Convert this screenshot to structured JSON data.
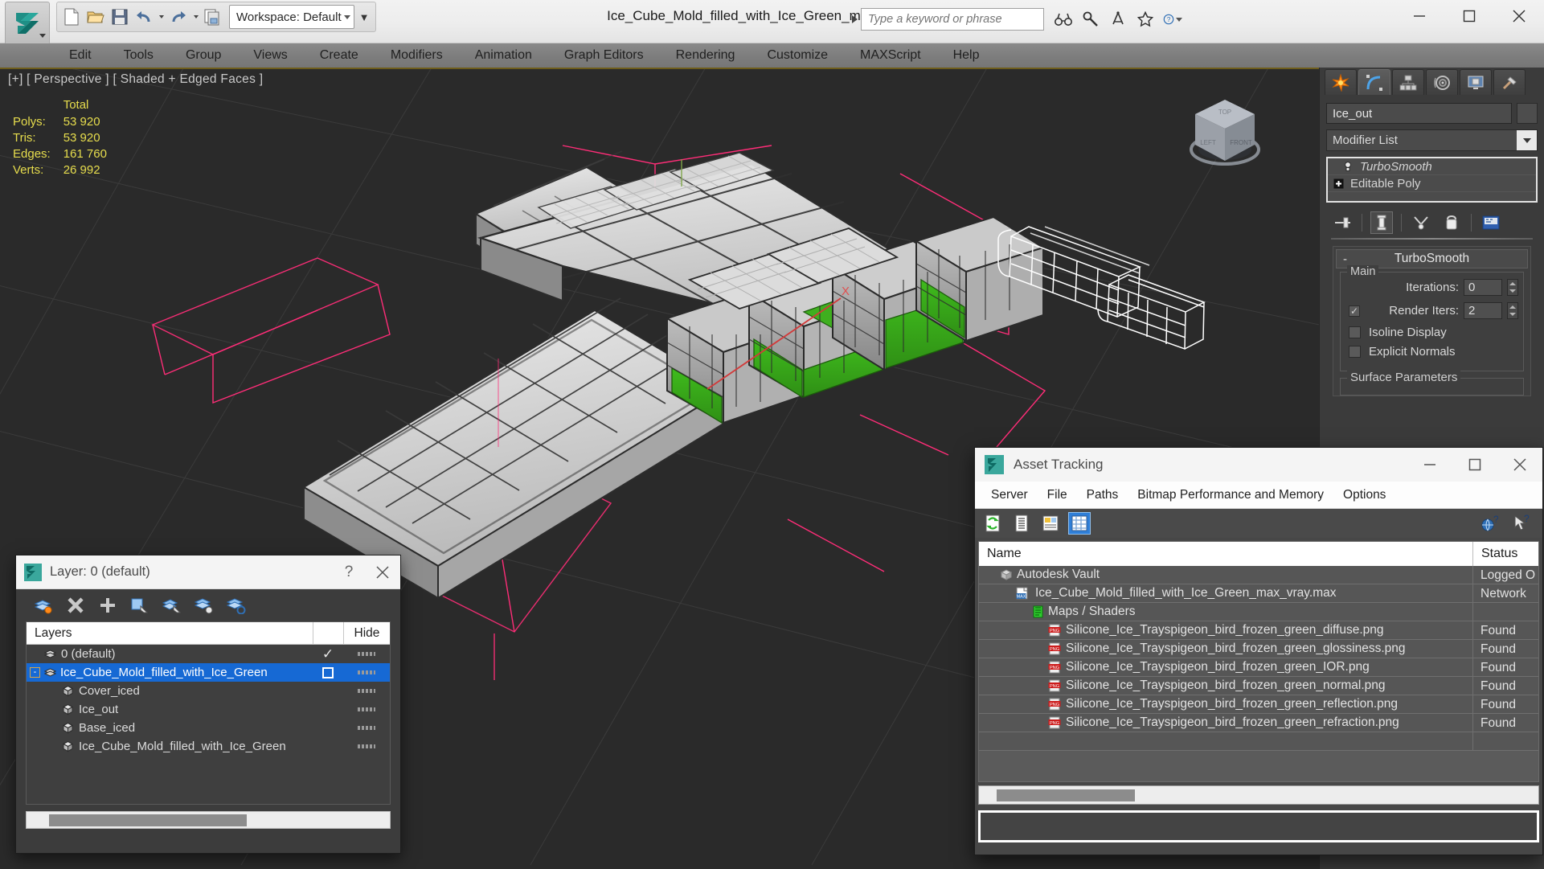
{
  "app": {
    "window_title": "Ice_Cube_Mold_filled_with_Ice_Green_max_vray.max",
    "logo_name": "3ds-max-logo"
  },
  "quick_access": {
    "workspace_label": "Workspace: Default",
    "buttons": [
      {
        "name": "new-file-icon",
        "tip": "New"
      },
      {
        "name": "open-file-icon",
        "tip": "Open"
      },
      {
        "name": "save-file-icon",
        "tip": "Save"
      },
      {
        "name": "undo-icon",
        "tip": "Undo"
      },
      {
        "name": "redo-icon",
        "tip": "Redo"
      },
      {
        "name": "project-folder-icon",
        "tip": "Set Project Folder"
      }
    ]
  },
  "search": {
    "placeholder": "Type a keyword or phrase",
    "icons": [
      "binoculars-icon",
      "wrench-icon",
      "compass-icon",
      "star-icon",
      "help-icon"
    ]
  },
  "window_controls": [
    "minimize",
    "maximize",
    "close"
  ],
  "menubar": {
    "items": [
      "Edit",
      "Tools",
      "Group",
      "Views",
      "Create",
      "Modifiers",
      "Animation",
      "Graph Editors",
      "Rendering",
      "Customize",
      "MAXScript",
      "Help"
    ]
  },
  "viewport": {
    "label": "[+] [ Perspective ] [ Shaded + Edged Faces ]",
    "stats": {
      "header": "Total",
      "rows": [
        {
          "label": "Polys:",
          "value": "53 920"
        },
        {
          "label": "Tris:",
          "value": "53 920"
        },
        {
          "label": "Edges:",
          "value": "161 760"
        },
        {
          "label": "Verts:",
          "value": "26 992"
        }
      ]
    },
    "viewcube": {
      "top": "TOP",
      "front": "FRONT",
      "left": "LEFT"
    },
    "gizmo_axis_label": "X",
    "colors": {
      "background": "#2a2a2a",
      "grid": "#3a3a3a",
      "selection_helper": "#ff2d78",
      "axis_x": "#d23a3a",
      "mesh_light": "#d8d8d8",
      "mesh_dark": "#3a3a3a",
      "ice_green": "#3faf1f",
      "wireframe_white": "#ffffff"
    }
  },
  "command_panel": {
    "tabs": [
      {
        "name": "create-tab",
        "icon": "star-burst-icon",
        "active": false
      },
      {
        "name": "modify-tab",
        "icon": "bent-arc-icon",
        "active": true
      },
      {
        "name": "hierarchy-tab",
        "icon": "hierarchy-icon",
        "active": false
      },
      {
        "name": "motion-tab",
        "icon": "motion-wheel-icon",
        "active": false
      },
      {
        "name": "display-tab",
        "icon": "monitor-icon",
        "active": false
      },
      {
        "name": "utilities-tab",
        "icon": "hammer-icon",
        "active": false
      }
    ],
    "object_name": "Ice_out",
    "modifier_list_label": "Modifier List",
    "modifier_stack": [
      {
        "label": "TurboSmooth",
        "italic": true,
        "icon": "lightbulb-icon"
      },
      {
        "label": "Editable Poly",
        "italic": false,
        "icon": "plus-box-icon"
      }
    ],
    "stack_tools": [
      {
        "name": "pin-stack-icon"
      },
      {
        "name": "show-end-result-icon"
      },
      {
        "name": "make-unique-icon"
      },
      {
        "name": "remove-modifier-icon"
      },
      {
        "name": "configure-modifier-sets-icon"
      }
    ],
    "rollout": {
      "title": "TurboSmooth",
      "collapse_symbol": "-",
      "group_main": "Main",
      "iterations_label": "Iterations:",
      "iterations_value": "0",
      "render_iters_label": "Render Iters:",
      "render_iters_value": "2",
      "render_iters_checked": true,
      "isoline_display": "Isoline Display",
      "explicit_normals": "Explicit Normals",
      "surface_parameters": "Surface Parameters"
    }
  },
  "layer_dialog": {
    "title": "Layer: 0 (default)",
    "help_symbol": "?",
    "tools": [
      {
        "name": "make-layer-current-icon"
      },
      {
        "name": "delete-layer-icon"
      },
      {
        "name": "create-new-layer-icon"
      },
      {
        "name": "add-selection-to-layer-icon"
      },
      {
        "name": "select-objects-in-layer-icon"
      },
      {
        "name": "set-layer-to-selection-icon"
      },
      {
        "name": "layer-settings-icon"
      }
    ],
    "columns": {
      "name": "Layers",
      "hide": "Hide"
    },
    "rows": [
      {
        "label": "0 (default)",
        "indent": 0,
        "icon": "layer-stack-icon",
        "selected": false,
        "current": true,
        "expander": ""
      },
      {
        "label": "Ice_Cube_Mold_filled_with_Ice_Green",
        "indent": 0,
        "icon": "layer-stack-icon",
        "selected": true,
        "current": false,
        "expander": "-"
      },
      {
        "label": "Cover_iced",
        "indent": 1,
        "icon": "object-cube-icon",
        "selected": false,
        "current": false,
        "expander": ""
      },
      {
        "label": "Ice_out",
        "indent": 1,
        "icon": "object-cube-icon",
        "selected": false,
        "current": false,
        "expander": ""
      },
      {
        "label": "Base_iced",
        "indent": 1,
        "icon": "object-cube-icon",
        "selected": false,
        "current": false,
        "expander": ""
      },
      {
        "label": "Ice_Cube_Mold_filled_with_Ice_Green",
        "indent": 1,
        "icon": "object-cube-icon",
        "selected": false,
        "current": false,
        "expander": ""
      }
    ]
  },
  "asset_tracking": {
    "title": "Asset Tracking",
    "menu": [
      "Server",
      "File",
      "Paths",
      "Bitmap Performance and Memory",
      "Options"
    ],
    "toolbar": [
      {
        "name": "refresh-icon",
        "active": false
      },
      {
        "name": "list-view-icon",
        "active": false
      },
      {
        "name": "detail-view-icon",
        "active": false
      },
      {
        "name": "grid-view-icon",
        "active": true
      }
    ],
    "toolbar_right": [
      {
        "name": "help-globe-icon"
      },
      {
        "name": "help-cursor-icon"
      }
    ],
    "columns": [
      "Name",
      "Status"
    ],
    "rows": [
      {
        "name": "Autodesk Vault",
        "status": "Logged O",
        "indent": 1,
        "icon": "vault-icon"
      },
      {
        "name": "Ice_Cube_Mold_filled_with_Ice_Green_max_vray.max",
        "status": "Network",
        "indent": 2,
        "icon": "max-file-icon"
      },
      {
        "name": "Maps / Shaders",
        "status": "",
        "indent": 3,
        "icon": "maps-shaders-icon"
      },
      {
        "name": "Silicone_Ice_Trayspigeon_bird_frozen_green_diffuse.png",
        "status": "Found",
        "indent": 4,
        "icon": "png-icon"
      },
      {
        "name": "Silicone_Ice_Trayspigeon_bird_frozen_green_glossiness.png",
        "status": "Found",
        "indent": 4,
        "icon": "png-icon"
      },
      {
        "name": "Silicone_Ice_Trayspigeon_bird_frozen_green_IOR.png",
        "status": "Found",
        "indent": 4,
        "icon": "png-icon"
      },
      {
        "name": "Silicone_Ice_Trayspigeon_bird_frozen_green_normal.png",
        "status": "Found",
        "indent": 4,
        "icon": "png-icon"
      },
      {
        "name": "Silicone_Ice_Trayspigeon_bird_frozen_green_reflection.png",
        "status": "Found",
        "indent": 4,
        "icon": "png-icon"
      },
      {
        "name": "Silicone_Ice_Trayspigeon_bird_frozen_green_refraction.png",
        "status": "Found",
        "indent": 4,
        "icon": "png-icon"
      }
    ]
  }
}
